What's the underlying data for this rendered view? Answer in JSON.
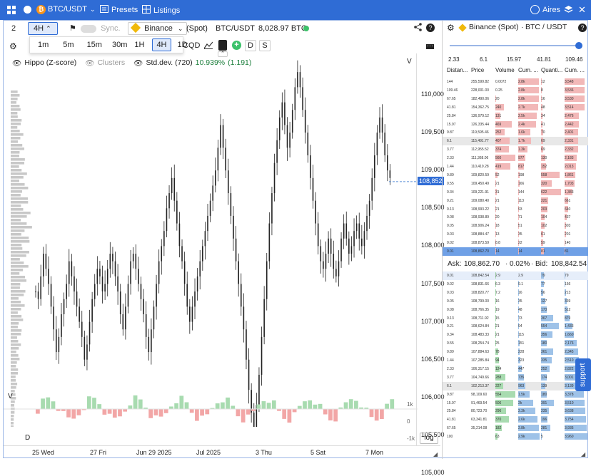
{
  "topbar": {
    "symbol": "BTC/USDT",
    "presets": "Presets",
    "listings": "Listings",
    "user": "Aires"
  },
  "toolbar": {
    "layout_num": "2",
    "timeframe": "4H",
    "sync": "Sync.",
    "exchange": "Binance",
    "market": "(Spot)",
    "pair": "BTC/USDT",
    "price": "8,028.97 BTC",
    "cqd": "CQD",
    "d_btn": "D",
    "s_btn": "S"
  },
  "timeframes": [
    "1m",
    "5m",
    "15m",
    "30m",
    "1H",
    "4H",
    "1D"
  ],
  "indicators": {
    "hippo": "Hippo (Z-score)",
    "clusters": "Clusters",
    "stddev": "Std.dev. (720)",
    "stddev_val": "10.939%",
    "stddev_val2": "(1.191)"
  },
  "chart": {
    "current_price": "108,852",
    "price_ticks": [
      "110,000",
      "109,500",
      "109,000",
      "108,500",
      "108,000",
      "107,500",
      "107,000",
      "106,500",
      "106,000",
      "105,500",
      "105,000"
    ],
    "vol_ticks": [
      "1k",
      "0",
      "-1k"
    ],
    "time_labels": [
      "25 Wed",
      "27 Fri",
      "Jun 29 2025",
      "Jul 2025",
      "3 Thu",
      "5 Sat",
      "7 Mon"
    ],
    "v_label": "V",
    "d_label": "D",
    "log_btn": "log"
  },
  "orderbook": {
    "header_exchange": "Binance (Spot)",
    "header_pair": "BTC / USDT",
    "scale": [
      "2.33",
      "6.1",
      "15.97",
      "41.81",
      "109.46"
    ],
    "columns": [
      "Distan...",
      "Price",
      "Volume",
      "Cum. ...",
      "Quanti...",
      "Cum. ..."
    ],
    "asks": [
      [
        "144",
        "255,599.82",
        "0.0072",
        "2.8k",
        "12",
        "3,548"
      ],
      [
        "109.46",
        "228,001.00",
        "0.25",
        "2.8k",
        "8",
        "3,536"
      ],
      [
        "67.65",
        "182,490.06",
        "20",
        "2.8k",
        "16",
        "3,530"
      ],
      [
        "41.81",
        "154,362.75",
        "240",
        "2.7k",
        "48",
        "3,514"
      ],
      [
        "25.84",
        "136,979.12",
        "131",
        "2.5k",
        "34",
        "2,476"
      ],
      [
        "15.97",
        "126,335.44",
        "469",
        "2.4k",
        "41",
        "2,442"
      ],
      [
        "9.87",
        "119,595.46",
        "252",
        "1.6k",
        "70",
        "2,401"
      ],
      [
        "6.1",
        "115,491.77",
        "407",
        "1.7k",
        "69",
        "2,331"
      ],
      [
        "3.77",
        "112,955.52",
        "374",
        "1.3k",
        "69",
        "2,332"
      ],
      [
        "2.33",
        "111,368.06",
        "560",
        "977",
        "130",
        "2,183"
      ],
      [
        "1.44",
        "110,419.28",
        "419",
        "817",
        "152",
        "2,013"
      ],
      [
        "0.89",
        "109,820.59",
        "52",
        "198",
        "558",
        "1,861"
      ],
      [
        "0.55",
        "109,450.49",
        "21",
        "166",
        "320",
        "1,703"
      ],
      [
        "0.34",
        "109,221.91",
        "31",
        "144",
        "622",
        "1,383"
      ],
      [
        "0.21",
        "109,080.40",
        "21",
        "113",
        "221",
        "661"
      ],
      [
        "0.13",
        "108,993.22",
        "21",
        "93",
        "203",
        "640"
      ],
      [
        "0.08",
        "108,938.89",
        "20",
        "71",
        "104",
        "437"
      ],
      [
        "0.05",
        "108,906.24",
        "18",
        "51",
        "102",
        "303"
      ],
      [
        "0.03",
        "108,884.47",
        "13",
        "35",
        "61",
        "201"
      ],
      [
        "0.02",
        "108,873.59",
        "8.8",
        "22",
        "59",
        "140"
      ],
      [
        "0.01",
        "108,862.70",
        "14",
        "14",
        "81",
        "81"
      ]
    ],
    "ask_label": "Ask:",
    "ask": "108,862.70",
    "spread": "0.02%",
    "bid_label": "Bid:",
    "bid": "108,842.54",
    "bids": [
      [
        "0.01",
        "108,842.54",
        "2.9",
        "2.9",
        "79",
        "79"
      ],
      [
        "0.02",
        "108,831.66",
        "6.3",
        "9.1",
        "77",
        "156"
      ],
      [
        "0.03",
        "108,820.77",
        "7.2",
        "16",
        "56",
        "213"
      ],
      [
        "0.05",
        "108,799.00",
        "16",
        "35",
        "127",
        "339"
      ],
      [
        "0.08",
        "108,766.35",
        "19",
        "48",
        "173",
        "512"
      ],
      [
        "0.13",
        "108,711.92",
        "15",
        "73",
        "367",
        "879"
      ],
      [
        "0.21",
        "108,624.84",
        "21",
        "94",
        "554",
        "1,433"
      ],
      [
        "0.34",
        "108,483.33",
        "21",
        "115",
        "356",
        "1,660"
      ],
      [
        "0.55",
        "108,254.74",
        "25",
        "151",
        "180",
        "2,176"
      ],
      [
        "0.89",
        "107,884.63",
        "78",
        "228",
        "361",
        "2,345"
      ],
      [
        "1.44",
        "107,285.84",
        "94",
        "323",
        "335",
        "2,510"
      ],
      [
        "2.33",
        "106,317.15",
        "124",
        "447",
        "252",
        "2,822"
      ],
      [
        "3.77",
        "104,749.66",
        "288",
        "735",
        "174",
        "3,001"
      ],
      [
        "6.1",
        "102,213.37",
        "227",
        "963",
        "139",
        "3,139"
      ],
      [
        "9.87",
        "98,109.60",
        "554",
        "1.5k",
        "180",
        "3,378"
      ],
      [
        "15.97",
        "91,469.54",
        "506",
        "2k",
        "391",
        "3,510"
      ],
      [
        "25.84",
        "80,723.70",
        "296",
        "2.3k",
        "235",
        "3,638"
      ],
      [
        "41.81",
        "63,341.81",
        "370",
        "2.6k",
        "196",
        "3,754"
      ],
      [
        "67.65",
        "35,214.08",
        "182",
        "2.8k",
        "281",
        "3,935"
      ],
      [
        "100",
        "",
        "63",
        "2.9k",
        "5",
        "3,960"
      ]
    ]
  },
  "support": "support",
  "colors": {
    "brand": "#2f6cd5",
    "ask": "#f2b8b8",
    "bid": "#9ec2e8",
    "green": "#a8dbb0",
    "red": "#f2a6a6"
  }
}
